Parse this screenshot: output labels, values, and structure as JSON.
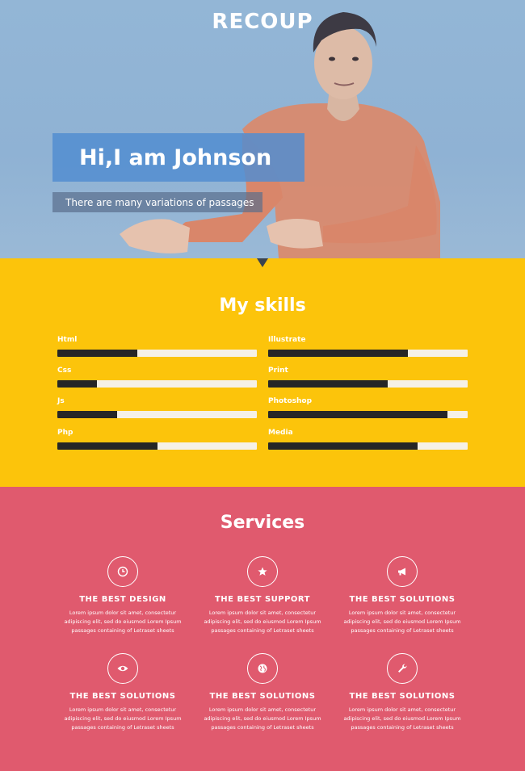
{
  "hero": {
    "brand": "RECOUP",
    "headline": "Hi,I am Johnson",
    "subtitle": "There are many variations of passages"
  },
  "skills": {
    "title": "My skills",
    "items": [
      {
        "label": "Html",
        "level": 0.4
      },
      {
        "label": "Css",
        "level": 0.2
      },
      {
        "label": "Js",
        "level": 0.3
      },
      {
        "label": "Php",
        "level": 0.5
      },
      {
        "label": "Illustrate",
        "level": 0.7
      },
      {
        "label": "Print",
        "level": 0.6
      },
      {
        "label": "Photoshop",
        "level": 0.9
      },
      {
        "label": "Media",
        "level": 0.75
      }
    ]
  },
  "services": {
    "title": "Services",
    "items": [
      {
        "icon": "clock-icon",
        "title": "THE BEST DESIGN",
        "text": "Lorem ipsum dolor sit amet, consectetur adipiscing elit, sed do eiusmod Lorem Ipsum passages containing of Letraset sheets"
      },
      {
        "icon": "star-icon",
        "title": "THE BEST SUPPORT",
        "text": "Lorem ipsum dolor sit amet, consectetur adipiscing elit, sed do eiusmod Lorem Ipsum passages containing of Letraset sheets"
      },
      {
        "icon": "megaphone-icon",
        "title": "THE BEST SOLUTIONS",
        "text": "Lorem ipsum dolor sit amet, consectetur adipiscing elit, sed do eiusmod Lorem Ipsum passages containing of Letraset sheets"
      },
      {
        "icon": "eye-icon",
        "title": "THE BEST SOLUTIONS",
        "text": "Lorem ipsum dolor sit amet, consectetur adipiscing elit, sed do eiusmod Lorem Ipsum passages containing of Letraset sheets"
      },
      {
        "icon": "globe-icon",
        "title": "THE BEST SOLUTIONS",
        "text": "Lorem ipsum dolor sit amet, consectetur adipiscing elit, sed do eiusmod Lorem Ipsum passages containing of Letraset sheets"
      },
      {
        "icon": "wrench-icon",
        "title": "THE BEST SOLUTIONS",
        "text": "Lorem ipsum dolor sit amet, consectetur adipiscing elit, sed do eiusmod Lorem Ipsum passages containing of Letraset sheets"
      }
    ]
  },
  "colors": {
    "hero_bg": "#93b6d6",
    "skills_bg": "#fcc40b",
    "services_bg": "#e05a6e",
    "bar_fill": "#262626",
    "bar_track": "#f6f1e6"
  }
}
